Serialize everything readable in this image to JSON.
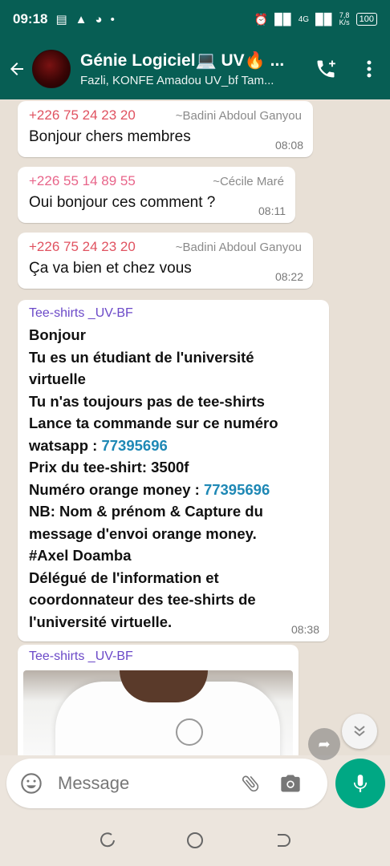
{
  "status_bar": {
    "time": "09:18",
    "icons_left": [
      "message-icon",
      "flask-icon",
      "shazam-icon",
      "dot-icon"
    ],
    "speed_value": "7,8",
    "speed_unit": "K/s",
    "battery": "100",
    "network": "4G"
  },
  "header": {
    "title": "Génie Logiciel💻 UV🔥 ...",
    "subtitle": "Fazli, KONFE Amadou UV_bf Tam..."
  },
  "messages": [
    {
      "phone": "+226 75 24 23 20",
      "alias": "~Badini Abdoul Ganyou",
      "text": "Bonjour chers membres",
      "time": "08:08",
      "phone_color": "#e05260"
    },
    {
      "phone": "+226 55 14 89 55",
      "alias": "~Cécile Maré",
      "text": "Oui bonjour ces comment ?",
      "time": "08:11",
      "phone_color": "#e8658a"
    },
    {
      "phone": "+226 75 24 23 20",
      "alias": "~Badini Abdoul Ganyou",
      "text": "Ça va bien et chez vous",
      "time": "08:22",
      "phone_color": "#e05260"
    }
  ],
  "announcement": {
    "sender": "Tee-shirts _UV-BF",
    "line1": "Bonjour",
    "line2": "Tu es un étudiant de l'université",
    "line3": "virtuelle",
    "line4": "Tu n'as toujours pas de tee-shirts",
    "line5": "Lance ta commande sur ce numéro",
    "line6_prefix": "watsapp : ",
    "line6_link": "77395696",
    "line7": "Prix du tee-shirt: 3500f",
    "line8_prefix": "Numéro orange money : ",
    "line8_link": "77395696",
    "line9": "NB: Nom & prénom & Capture du",
    "line10": "message d'envoi orange money.",
    "line11": "#Axel Doamba",
    "line12": "Délégué de l'information et",
    "line13": "coordonnateur des tee-shirts de",
    "line14": "l'université virtuelle.",
    "time": "08:38"
  },
  "image_message": {
    "sender": "Tee-shirts _UV-BF"
  },
  "input": {
    "placeholder": "Message"
  },
  "colors": {
    "header_bg": "#075e54",
    "accent": "#00a884",
    "chat_bg": "#e8e0d6"
  }
}
